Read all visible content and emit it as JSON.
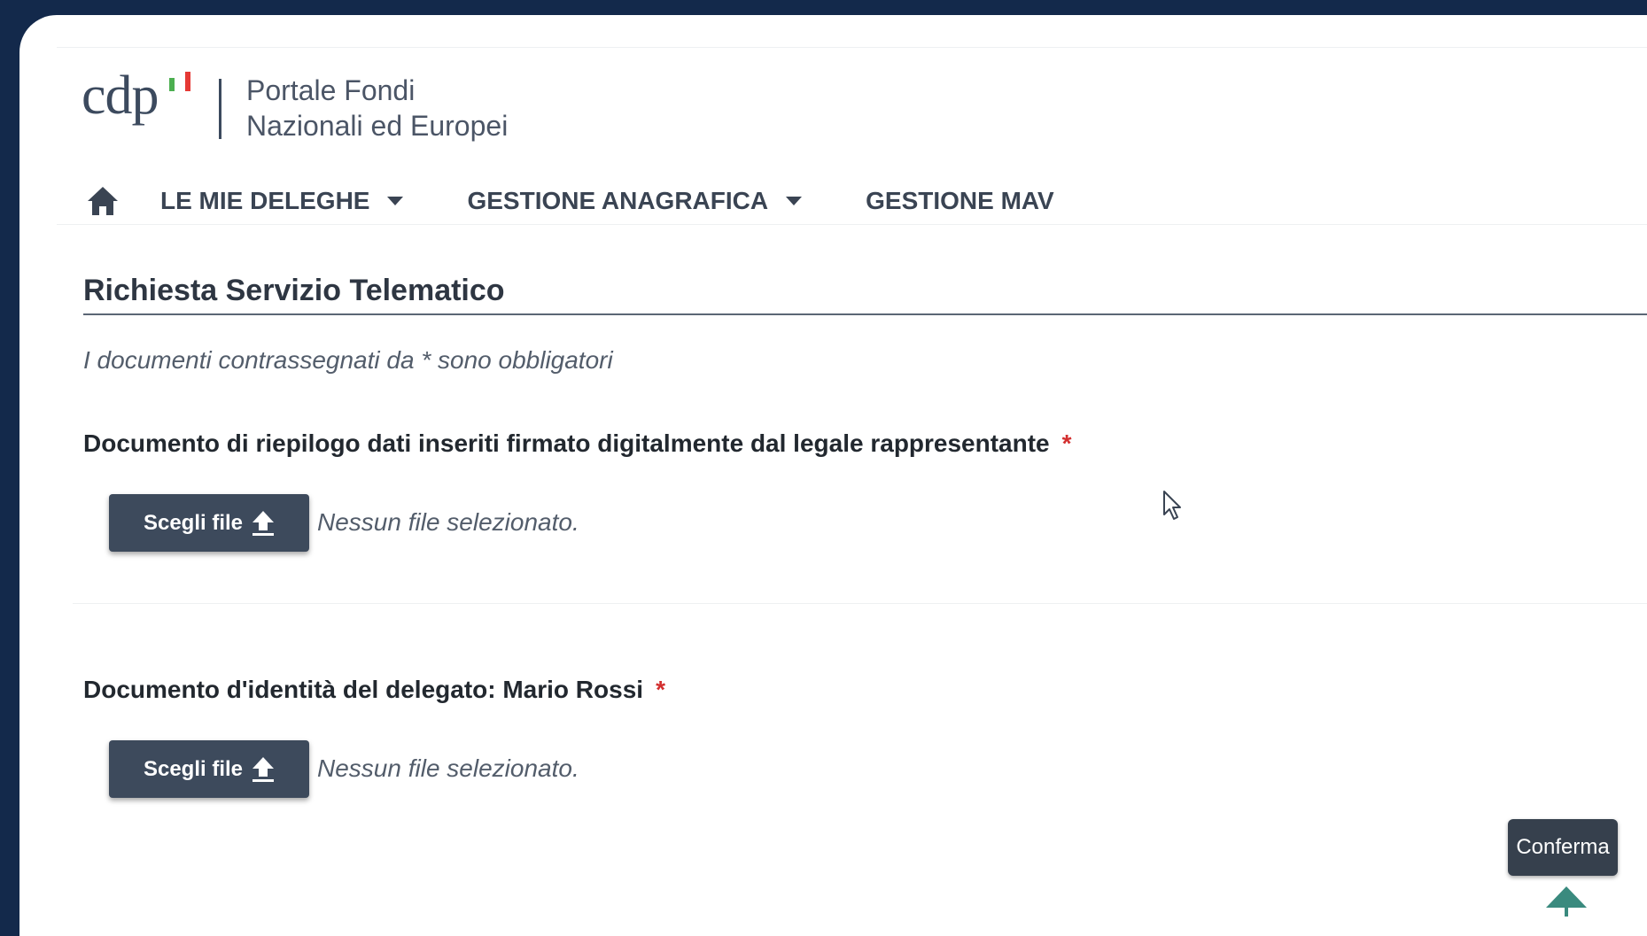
{
  "header": {
    "logo_text": "cdp",
    "portal_title_line1": "Portale Fondi",
    "portal_title_line2": "Nazionali ed Europei"
  },
  "nav": {
    "home_icon": "home-icon",
    "items": [
      {
        "label": "LE MIE DELEGHE",
        "has_dropdown": true
      },
      {
        "label": "GESTIONE ANAGRAFICA",
        "has_dropdown": true
      },
      {
        "label": "GESTIONE MAV",
        "has_dropdown": false
      }
    ]
  },
  "page": {
    "title": "Richiesta Servizio Telematico",
    "hint": "I documenti contrassegnati da * sono obbligatori"
  },
  "documents": [
    {
      "label": "Documento di riepilogo dati inseriti firmato digitalmente dal legale rappresentante",
      "required_mark": "*",
      "button_label": "Scegli file",
      "status": "Nessun file selezionato."
    },
    {
      "label": "Documento d'identità del delegato: Mario Rossi",
      "required_mark": "*",
      "button_label": "Scegli file",
      "status": "Nessun file selezionato."
    }
  ],
  "actions": {
    "confirm_label": "Conferma"
  },
  "colors": {
    "frame": "#13294b",
    "button": "#3d4a5c",
    "required": "#d32f2f",
    "scroll_arrow": "#3a8a7e"
  }
}
